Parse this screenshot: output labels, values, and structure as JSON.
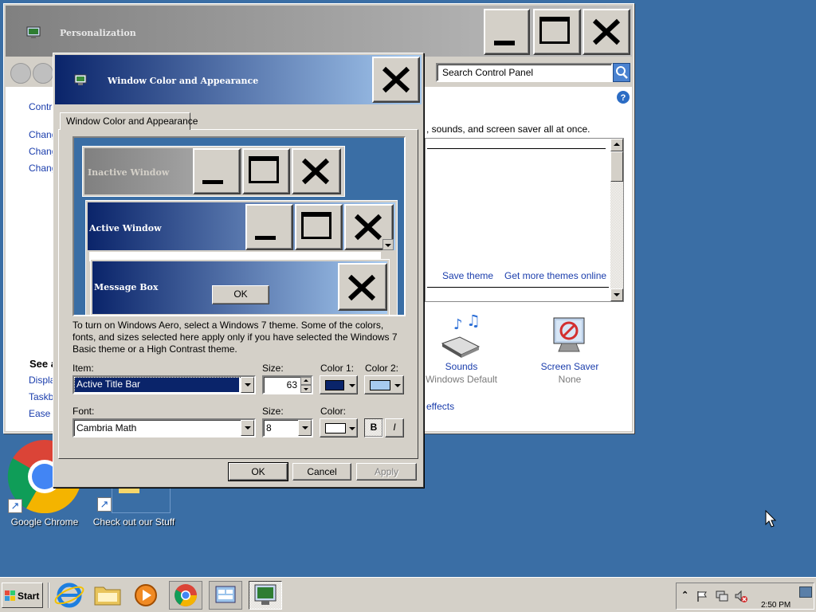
{
  "desktop": {
    "icons": [
      {
        "label": "Google Chrome"
      },
      {
        "label": "Check out our Stuff"
      }
    ]
  },
  "personalization": {
    "title": "Personalization",
    "search_placeholder": "Search Control Panel",
    "sidebar": {
      "links": [
        "Control",
        "Chang",
        "Chang",
        "Chang"
      ],
      "see_also": "See a",
      "see_also_links": [
        "Display",
        "Taskba",
        "Ease c"
      ]
    },
    "main": {
      "desc": ", sounds, and screen saver all at once.",
      "save_theme": "Save theme",
      "get_more": "Get more themes online",
      "sounds": {
        "label": "Sounds",
        "sub": "Windows Default"
      },
      "screensaver": {
        "label": "Screen Saver",
        "sub": "None"
      },
      "effects": "effects"
    }
  },
  "dialog": {
    "title": "Window Color and Appearance",
    "tab": "Window Color and Appearance",
    "preview": {
      "inactive": "Inactive Window",
      "active": "Active Window",
      "message_box": "Message Box",
      "ok": "OK"
    },
    "info": "To turn on Windows Aero, select a Windows 7 theme.  Some of the colors, fonts, and sizes selected here apply only if you have selected the Windows 7 Basic theme or a High Contrast theme.",
    "item_label": "Item:",
    "item_value": "Active Title Bar",
    "size_label": "Size:",
    "size_value": "63",
    "color1_label": "Color 1:",
    "color2_label": "Color 2:",
    "font_label": "Font:",
    "font_value": "Cambria Math",
    "font_size_label": "Size:",
    "font_size_value": "8",
    "color_label": "Color:",
    "bold": "B",
    "italic": "I",
    "ok": "OK",
    "cancel": "Cancel",
    "apply": "Apply",
    "colors": {
      "color1": "#0a246a",
      "color2": "#a6caf0",
      "font_color": "#ffffff"
    }
  },
  "taskbar": {
    "start": "Start",
    "clock": "2:50 PM"
  }
}
